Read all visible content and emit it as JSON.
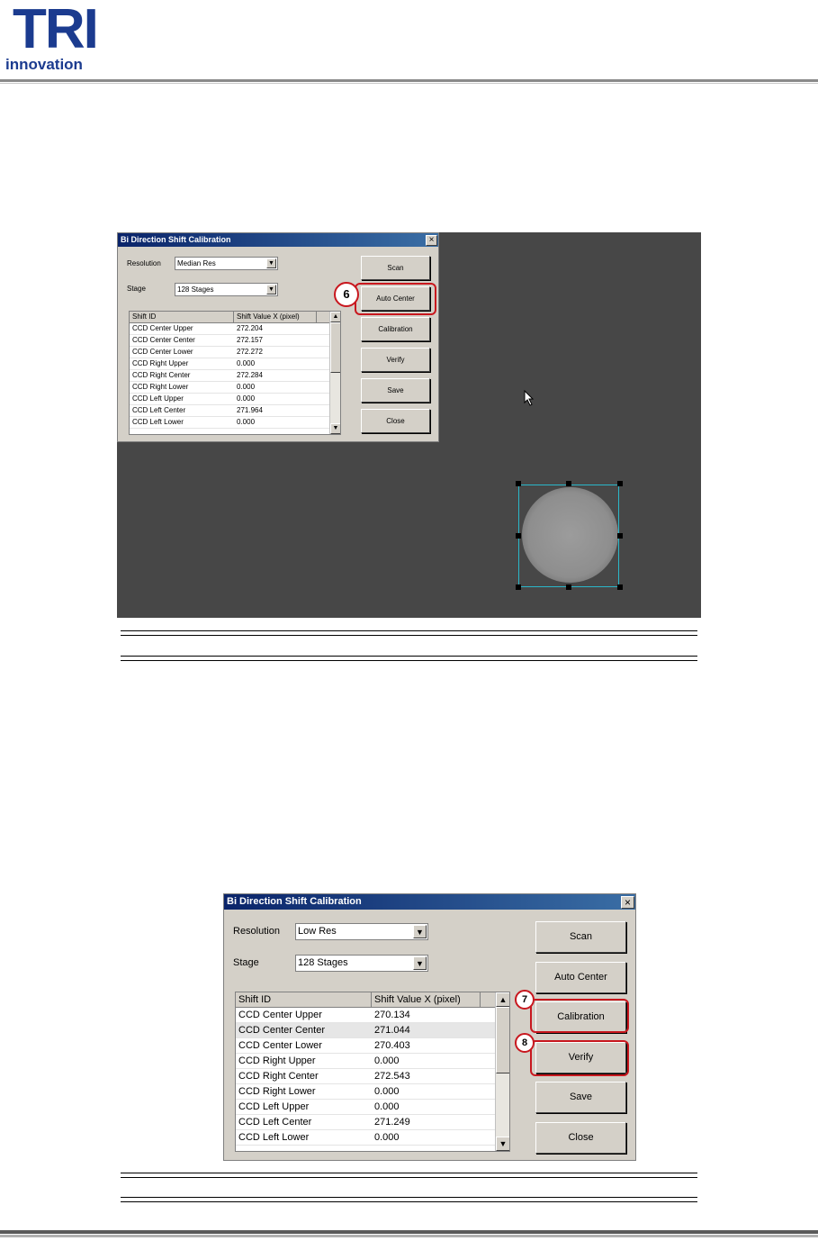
{
  "header": {
    "logo_text": "TRI",
    "logo_subtext": "innovation"
  },
  "figure1": {
    "window_title": "Bi Direction Shift Calibration",
    "close_glyph": "×",
    "resolution_label": "Resolution",
    "resolution_value": "Median Res",
    "stage_label": "Stage",
    "stage_value": "128 Stages",
    "columns": [
      "Shift ID",
      "Shift Value X (pixel)"
    ],
    "rows": [
      [
        "CCD Center Upper",
        "272.204"
      ],
      [
        "CCD Center Center",
        "272.157"
      ],
      [
        "CCD Center Lower",
        "272.272"
      ],
      [
        "CCD Right Upper",
        "0.000"
      ],
      [
        "CCD Right Center",
        "272.284"
      ],
      [
        "CCD Right Lower",
        "0.000"
      ],
      [
        "CCD Left Upper",
        "0.000"
      ],
      [
        "CCD Left Center",
        "271.964"
      ],
      [
        "CCD Left Lower",
        "0.000"
      ]
    ],
    "buttons": [
      "Scan",
      "Auto Center",
      "Calibration",
      "Verify",
      "Save",
      "Close"
    ],
    "callout_number": "6"
  },
  "figure2": {
    "window_title": "Bi Direction Shift Calibration",
    "close_glyph": "×",
    "resolution_label": "Resolution",
    "resolution_value": "Low Res",
    "stage_label": "Stage",
    "stage_value": "128 Stages",
    "columns": [
      "Shift ID",
      "Shift Value X (pixel)"
    ],
    "rows": [
      [
        "CCD Center Upper",
        "270.134"
      ],
      [
        "CCD Center Center",
        "271.044"
      ],
      [
        "CCD Center Lower",
        "270.403"
      ],
      [
        "CCD Right Upper",
        "0.000"
      ],
      [
        "CCD Right Center",
        "272.543"
      ],
      [
        "CCD Right Lower",
        "0.000"
      ],
      [
        "CCD Left Upper",
        "0.000"
      ],
      [
        "CCD Left Center",
        "271.249"
      ],
      [
        "CCD Left Lower",
        "0.000"
      ]
    ],
    "buttons": [
      "Scan",
      "Auto Center",
      "Calibration",
      "Verify",
      "Save",
      "Close"
    ],
    "callout_numbers": [
      "7",
      "8"
    ]
  },
  "colors": {
    "brand": "#1b3b8f",
    "callout": "#c8171e",
    "camera_background": "#474747",
    "selection_box": "#2ab7c9"
  }
}
